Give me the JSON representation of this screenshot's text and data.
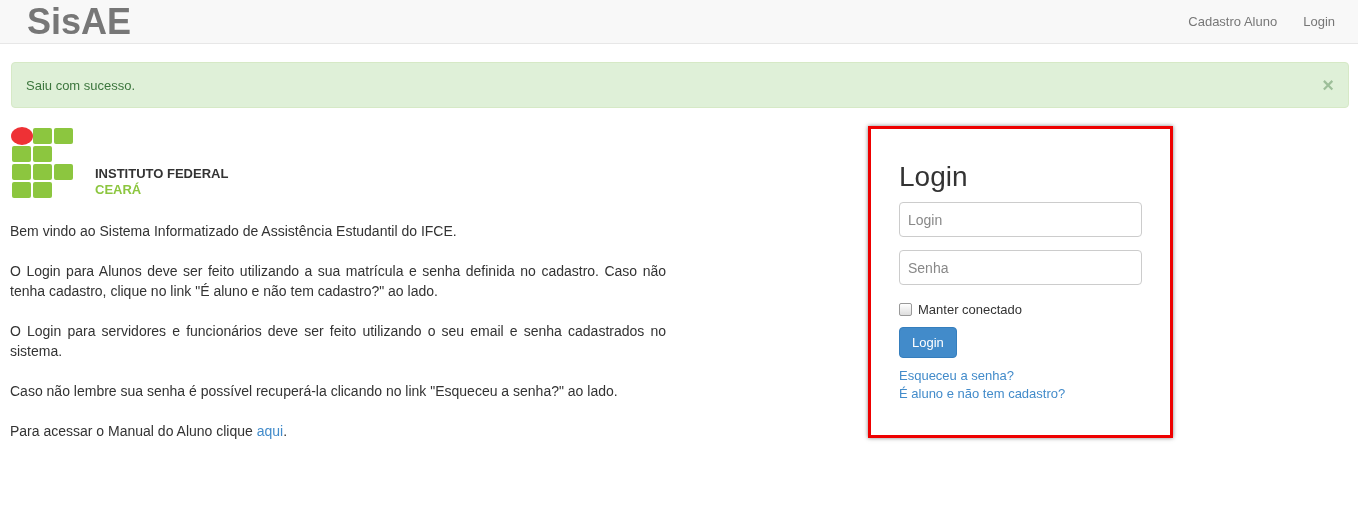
{
  "navbar": {
    "brand": "SisAE",
    "links": [
      "Cadastro Aluno",
      "Login"
    ]
  },
  "alert": {
    "message": "Saiu com sucesso.",
    "close": "×"
  },
  "logo": {
    "line_1": "INSTITUTO FEDERAL",
    "line_2": "CEARÁ"
  },
  "paragraphs": [
    {
      "text": "Bem vindo ao Sistema Informatizado de Assistência Estudantil do IFCE."
    },
    {
      "text": "O Login para Alunos deve ser feito utilizando a sua matrícula e senha definida no cadastro. Caso não tenha cadastro, clique no link \"É aluno e não tem cadastro?\" ao lado."
    },
    {
      "text": "O Login para servidores e funcionários deve ser feito utilizando o seu email e senha cadastrados no sistema."
    },
    {
      "text": "Caso não lembre sua senha é possível recuperá-la clicando no link \"Esqueceu a senha?\" ao lado."
    },
    {
      "text": "Para acessar o Manual do Aluno clique ",
      "link": "aqui",
      "after": "."
    }
  ],
  "login": {
    "title": "Login",
    "fields": [
      {
        "placeholder": "Login"
      },
      {
        "placeholder": "Senha"
      }
    ],
    "remember": {
      "label": "Manter conectado",
      "checked": false
    },
    "button": "Login",
    "links": [
      "Esqueceu a senha?",
      "É aluno e não tem cadastro?"
    ]
  }
}
